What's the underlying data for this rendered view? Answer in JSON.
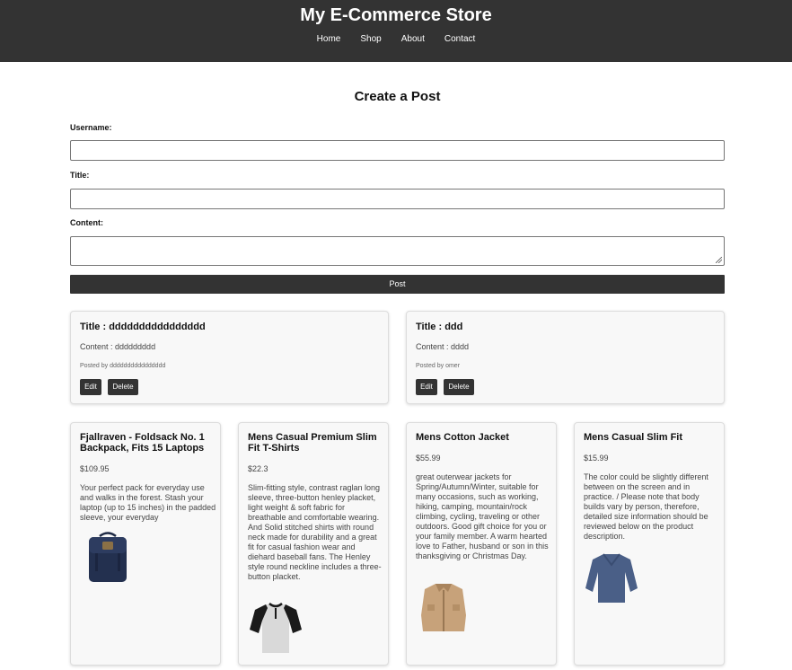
{
  "header": {
    "site_title": "My E-Commerce Store",
    "nav": [
      "Home",
      "Shop",
      "About",
      "Contact"
    ]
  },
  "form": {
    "title": "Create a Post",
    "username_label": "Username:",
    "title_label": "Title:",
    "content_label": "Content:",
    "username_value": "",
    "title_value": "",
    "content_value": "",
    "post_button": "Post"
  },
  "posts": [
    {
      "title": "Title : dddddddddddddddd",
      "content": "Content : ddddddddd",
      "posted_by": "Posted by dddddddddddddddd",
      "edit_label": "Edit",
      "delete_label": "Delete"
    },
    {
      "title": "Title : ddd",
      "content": "Content : dddd",
      "posted_by": "Posted by omer",
      "edit_label": "Edit",
      "delete_label": "Delete"
    }
  ],
  "products": [
    {
      "name": "Fjallraven - Foldsack No. 1 Backpack, Fits 15 Laptops",
      "price": "$109.95",
      "description": "Your perfect pack for everyday use and walks in the forest. Stash your laptop (up to 15 inches) in the padded sleeve, your everyday",
      "image": "backpack"
    },
    {
      "name": "Mens Casual Premium Slim Fit T-Shirts",
      "price": "$22.3",
      "description": "Slim-fitting style, contrast raglan long sleeve, three-button henley placket, light weight & soft fabric for breathable and comfortable wearing. And Solid stitched shirts with round neck made for durability and a great fit for casual fashion wear and diehard baseball fans. The Henley style round neckline includes a three-button placket.",
      "image": "raglan-tshirt"
    },
    {
      "name": "Mens Cotton Jacket",
      "price": "$55.99",
      "description": "great outerwear jackets for Spring/Autumn/Winter, suitable for many occasions, such as working, hiking, camping, mountain/rock climbing, cycling, traveling or other outdoors. Good gift choice for you or your family member. A warm hearted love to Father, husband or son in this thanksgiving or Christmas Day.",
      "image": "cotton-jacket"
    },
    {
      "name": "Mens Casual Slim Fit",
      "price": "$15.99",
      "description": "The color could be slightly different between on the screen and in practice. / Please note that body builds vary by person, therefore, detailed size information should be reviewed below on the product description.",
      "image": "slim-fit-shirt"
    }
  ],
  "colors": {
    "header_bg": "#333333",
    "card_bg": "#f8f8f8",
    "button_bg": "#333333"
  }
}
